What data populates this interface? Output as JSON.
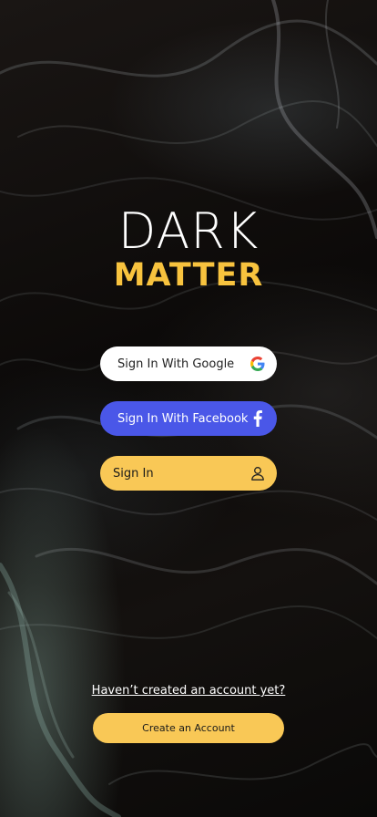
{
  "logo": {
    "top": "DARK",
    "bottom": "MATTER"
  },
  "buttons": {
    "google": {
      "label": "Sign In With Google",
      "icon": "google-icon"
    },
    "facebook": {
      "label": "Sign In With Facebook",
      "icon": "facebook-icon"
    },
    "signin": {
      "label": "Sign In",
      "icon": "user-icon"
    }
  },
  "account": {
    "prompt": "Haven’t created an account yet?",
    "create_label": "Create an Account"
  },
  "colors": {
    "accent": "#f9c856",
    "logo_yellow": "#f8c33e",
    "facebook": "#4a57e8",
    "background": "#0d0b0a"
  }
}
